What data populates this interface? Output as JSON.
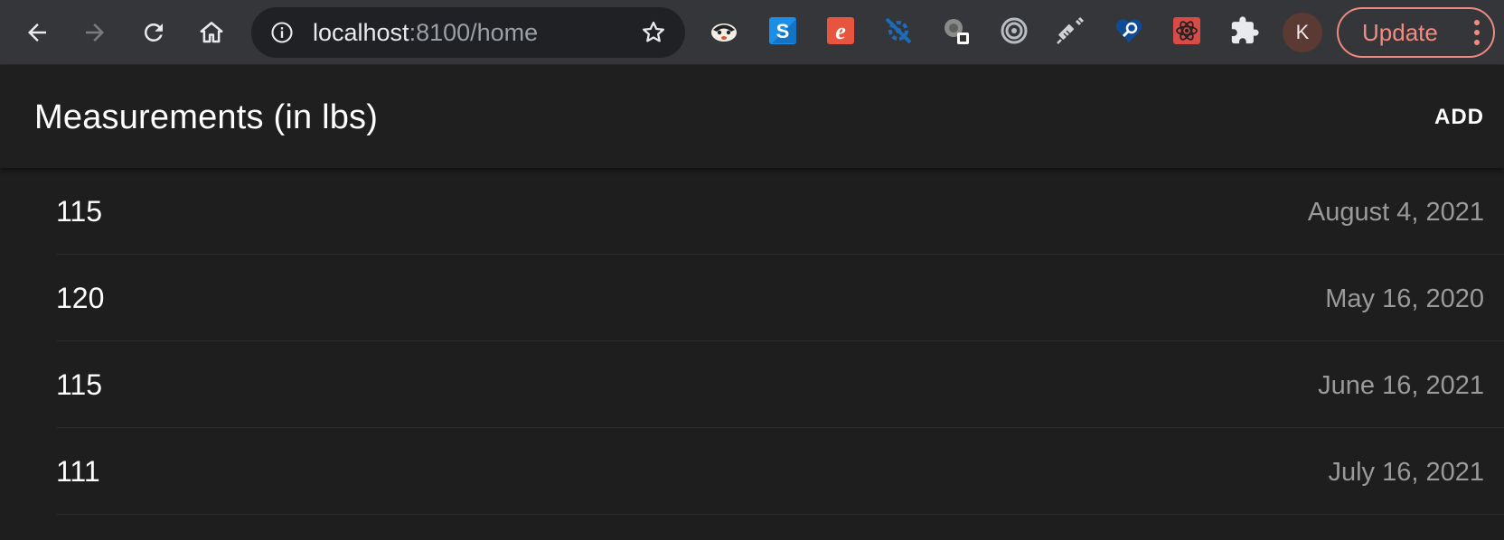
{
  "browser": {
    "url_host": "localhost",
    "url_path": ":8100/home",
    "profile_initial": "K",
    "update_label": "Update",
    "extensions": [
      "badger-icon",
      "s-extension-icon",
      "e-extension-icon",
      "disconnect-icon",
      "gray-extension-icon",
      "target-icon",
      "syringe-icon",
      "heart-search-icon",
      "react-devtools-icon",
      "puzzle-icon"
    ]
  },
  "app": {
    "title": "Measurements (in lbs)",
    "add_label": "ADD"
  },
  "measurements": [
    {
      "value": "115",
      "date": "August 4, 2021"
    },
    {
      "value": "120",
      "date": "May 16, 2020"
    },
    {
      "value": "115",
      "date": "June 16, 2021"
    },
    {
      "value": "111",
      "date": "July 16, 2021"
    }
  ],
  "colors": {
    "toolbar_bg": "#35363a",
    "omnibox_bg": "#202124",
    "app_bg": "#1f1f1f",
    "update_accent": "#f28b82",
    "avatar_bg": "#5b3a33"
  }
}
